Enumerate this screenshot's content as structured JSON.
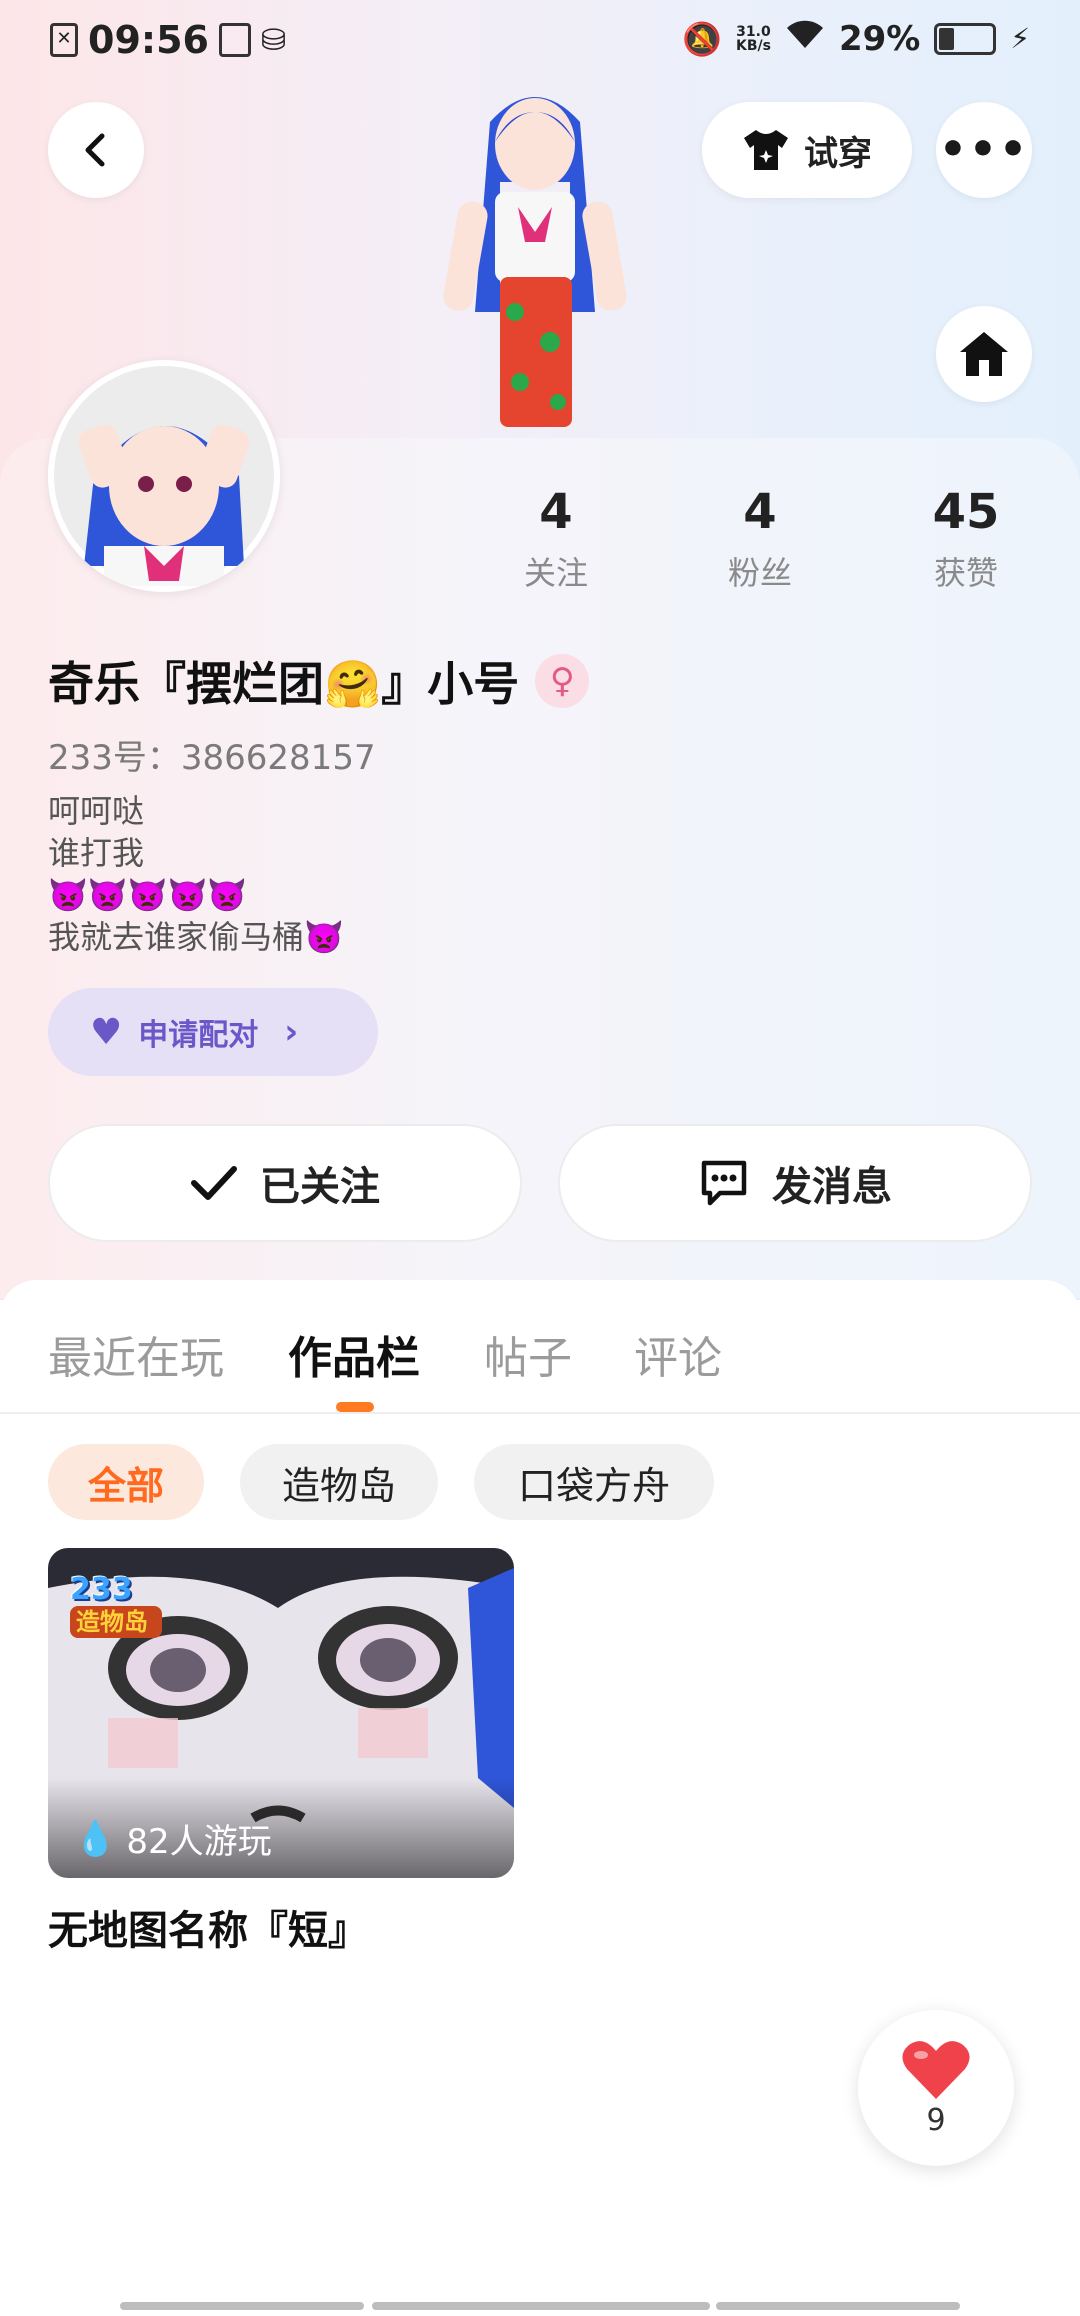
{
  "status_bar": {
    "time": "09:56",
    "net_speed_value": "31.0",
    "net_speed_unit": "KB/s",
    "battery_percent_text": "29%",
    "battery_level": 0.29
  },
  "header": {
    "try_on_label": "试穿"
  },
  "stats": [
    {
      "num": "4",
      "label": "关注"
    },
    {
      "num": "4",
      "label": "粉丝"
    },
    {
      "num": "45",
      "label": "获赞"
    }
  ],
  "profile": {
    "name": "奇乐『摆烂团🤗』小号",
    "gender_symbol": "♀",
    "uid": "233号：386628157",
    "bio": "呵呵哒\n谁打我\n👿👿👿👿👿\n我就去谁家偷马桶👿",
    "match_label": "申请配对"
  },
  "actions": {
    "follow_label": "已关注",
    "message_label": "发消息"
  },
  "tabs": [
    "最近在玩",
    "作品栏",
    "帖子",
    "评论"
  ],
  "active_tab": 1,
  "filters": [
    "全部",
    "造物岛",
    "口袋方舟"
  ],
  "active_filter": 0,
  "work": {
    "badge_line1": "233",
    "badge_line2": "造物岛",
    "players": "82人游玩",
    "title": "无地图名称『短』"
  },
  "like": {
    "count": "9"
  },
  "colors": {
    "accent_orange": "#ff7a21",
    "match_purple": "#6b58c8",
    "heart_red": "#f0424a"
  }
}
